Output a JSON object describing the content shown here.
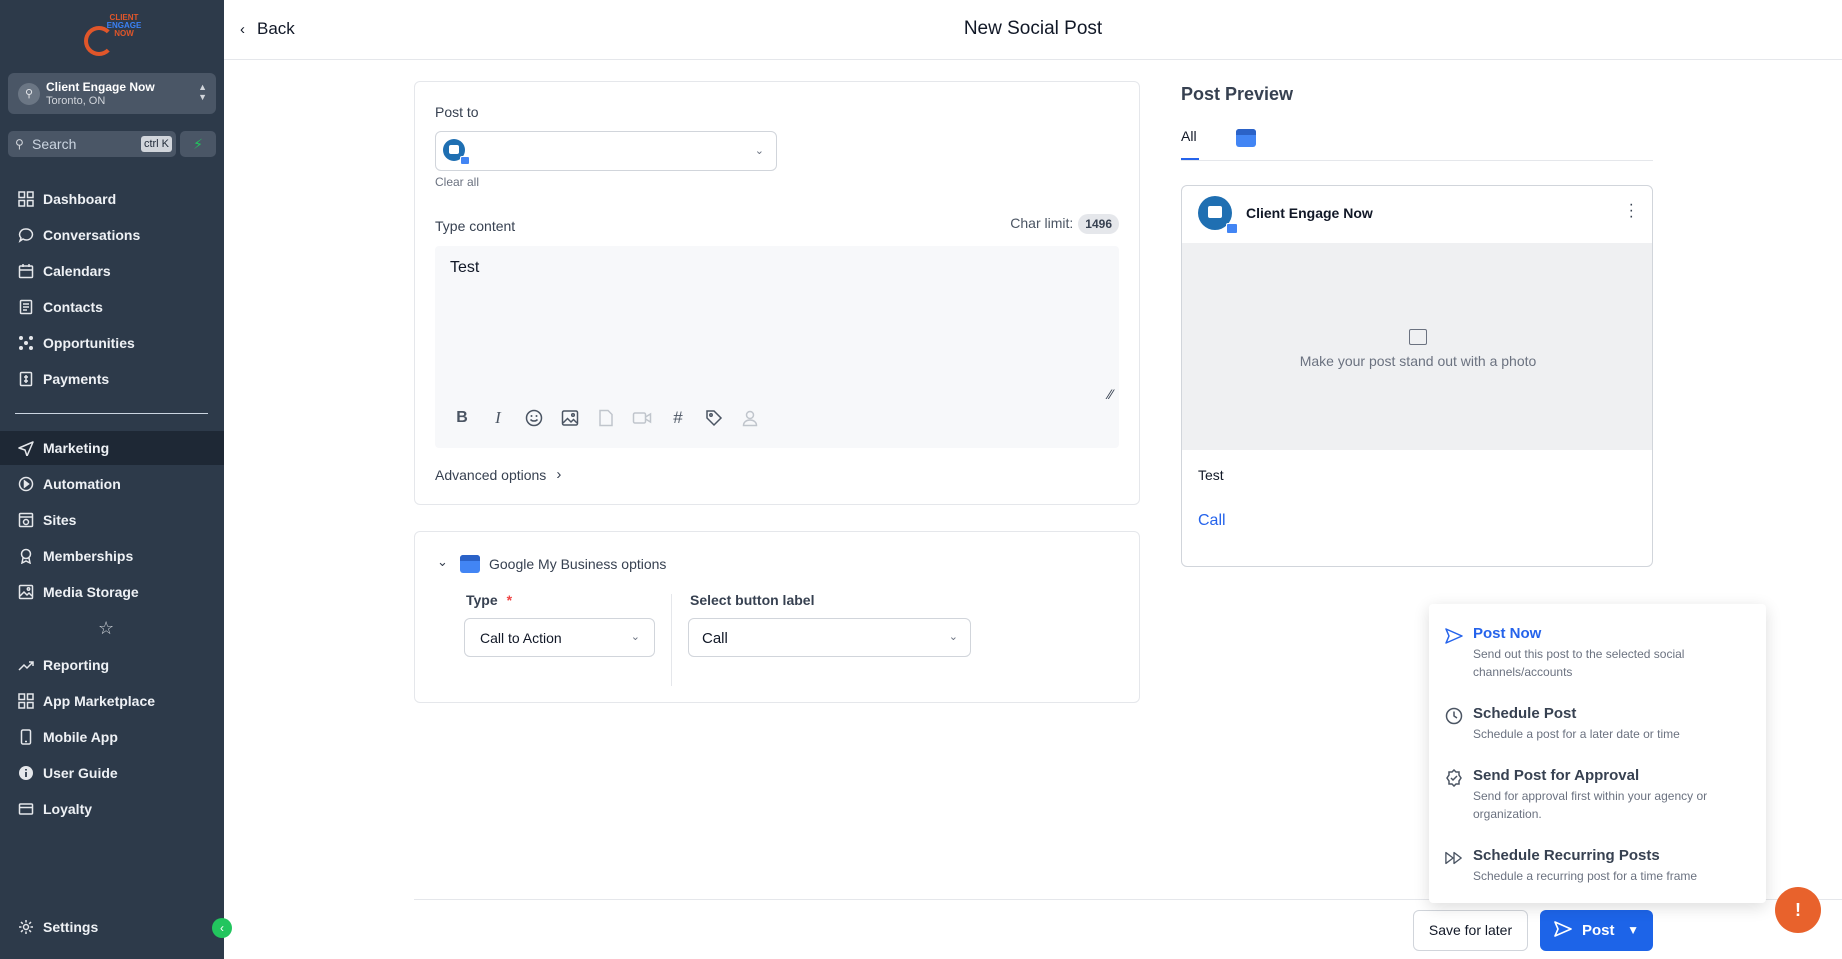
{
  "app": {
    "logo": {
      "line1": "CLIENT",
      "line2": "ENGAGE",
      "line3": "NOW"
    },
    "location": {
      "name": "Client Engage Now",
      "city": "Toronto, ON"
    },
    "search": {
      "placeholder": "Search",
      "shortcut": "ctrl K"
    }
  },
  "sidebar": {
    "items": [
      {
        "label": "Dashboard"
      },
      {
        "label": "Conversations"
      },
      {
        "label": "Calendars"
      },
      {
        "label": "Contacts"
      },
      {
        "label": "Opportunities"
      },
      {
        "label": "Payments"
      },
      {
        "label": "Marketing"
      },
      {
        "label": "Automation"
      },
      {
        "label": "Sites"
      },
      {
        "label": "Memberships"
      },
      {
        "label": "Media Storage"
      },
      {
        "label": "Reporting"
      },
      {
        "label": "App Marketplace"
      },
      {
        "label": "Mobile App"
      },
      {
        "label": "User Guide"
      },
      {
        "label": "Loyalty"
      },
      {
        "label": "Settings"
      }
    ],
    "active": "Marketing"
  },
  "header": {
    "back_label": "Back",
    "title": "New Social Post"
  },
  "composer": {
    "post_to_label": "Post to",
    "clear_all": "Clear all",
    "type_content_label": "Type content",
    "char_limit_label": "Char limit:",
    "char_limit_value": "1496",
    "content": "Test",
    "advanced_options": "Advanced options"
  },
  "gmb": {
    "title": "Google My Business options",
    "type_label": "Type",
    "required_mark": "*",
    "type_value": "Call to Action",
    "button_label_label": "Select button label",
    "button_label_value": "Call"
  },
  "preview": {
    "title": "Post Preview",
    "tab_all": "All",
    "account_name": "Client Engage Now",
    "photo_hint": "Make your post stand out with a photo",
    "post_text": "Test",
    "cta": "Call"
  },
  "post_menu": {
    "items": [
      {
        "title": "Post Now",
        "desc": "Send out this post to the selected social channels/accounts"
      },
      {
        "title": "Schedule Post",
        "desc": "Schedule a post for a later date or time"
      },
      {
        "title": "Send Post for Approval",
        "desc": "Send for approval first within your agency or organization."
      },
      {
        "title": "Schedule Recurring Posts",
        "desc": "Schedule a recurring post for a time frame"
      }
    ]
  },
  "footer": {
    "save_label": "Save for later",
    "post_label": "Post"
  },
  "colors": {
    "sidebar": "#2d3a4a",
    "primary": "#1d64e8",
    "accent": "#e8622c",
    "success": "#22c55e"
  }
}
